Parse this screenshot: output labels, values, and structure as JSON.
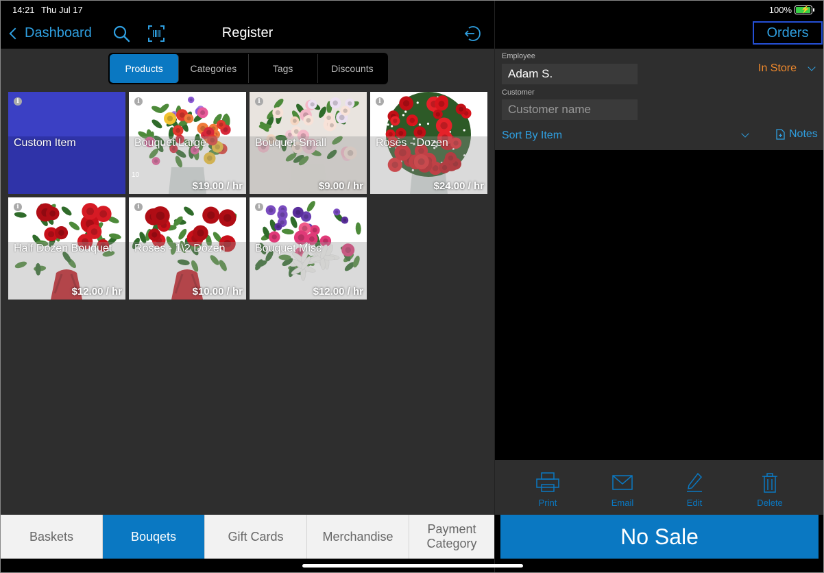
{
  "status_bar": {
    "time": "14:21",
    "date": "Thu Jul 17",
    "battery_pct": "100%",
    "battery_level": 1.0
  },
  "nav": {
    "back_label": "Dashboard",
    "title": "Register",
    "search_icon": "search-icon",
    "barcode_icon": "barcode-scan-icon",
    "exit_icon": "exit-icon"
  },
  "segments": [
    {
      "label": "Products",
      "active": true
    },
    {
      "label": "Categories",
      "active": false
    },
    {
      "label": "Tags",
      "active": false
    },
    {
      "label": "Discounts",
      "active": false
    }
  ],
  "products": [
    {
      "name": "Custom Item",
      "price": "",
      "qty": "",
      "kind": "custom"
    },
    {
      "name": "Bouquet Large",
      "price": "$19.00 / hr",
      "qty": "10",
      "kind": "mixed-large"
    },
    {
      "name": "Bouquet Small",
      "price": "$9.00 / hr",
      "qty": "",
      "kind": "pastel"
    },
    {
      "name": "Roses - Dozen",
      "price": "$24.00 / hr",
      "qty": "",
      "kind": "roses-dozen"
    },
    {
      "name": "Half Dozen Bouquet",
      "price": "$12.00 / hr",
      "qty": "",
      "kind": "roses-half"
    },
    {
      "name": "Roses - 1\\2 Dozen",
      "price": "$10.00 / hr",
      "qty": "",
      "kind": "roses-half"
    },
    {
      "name": "Bouquet Misc",
      "price": "$12.00 / hr",
      "qty": "",
      "kind": "lilies"
    }
  ],
  "bottom_tabs": [
    {
      "label": "Baskets",
      "active": false
    },
    {
      "label": "Bouqets",
      "active": true
    },
    {
      "label": "Gift Cards",
      "active": false
    },
    {
      "label": "Merchandise",
      "active": false
    },
    {
      "label": "Payment Category",
      "active": false
    }
  ],
  "order_panel": {
    "orders_label": "Orders",
    "employee_label": "Employee",
    "employee_value": "Adam S.",
    "customer_label": "Customer",
    "customer_placeholder": "Customer name",
    "location": "In Store",
    "sort_label": "Sort By Item",
    "notes_label": "Notes",
    "actions": [
      "Print",
      "Email",
      "Edit",
      "Delete"
    ],
    "primary_action": "No Sale"
  },
  "colors": {
    "accent": "#0a78c2",
    "link": "#2f9fe0",
    "orange": "#f28a2c",
    "custom_tile": "#3b40c4",
    "orders_outline": "#2550d6"
  }
}
